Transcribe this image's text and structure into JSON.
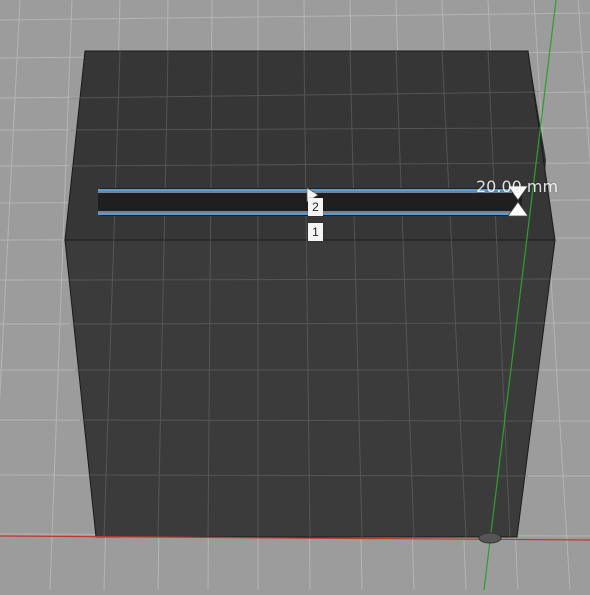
{
  "viewport": {
    "background": "#9c9c9c",
    "grid_color": "#bdbdbd",
    "y_axis_color": "#2ca02c",
    "x_axis_color": "#c0392b"
  },
  "model": {
    "body_color": "#3a3a3a",
    "top_face_color": "#343434",
    "slot_highlight_color": "#5b9bd5"
  },
  "dimension": {
    "value_label": "20.00 mm"
  },
  "edge_tags": [
    {
      "label": "2"
    },
    {
      "label": "1"
    }
  ],
  "icons": {
    "extrude_arrow": "extrude-arrow-icon",
    "origin": "origin-point-icon"
  }
}
